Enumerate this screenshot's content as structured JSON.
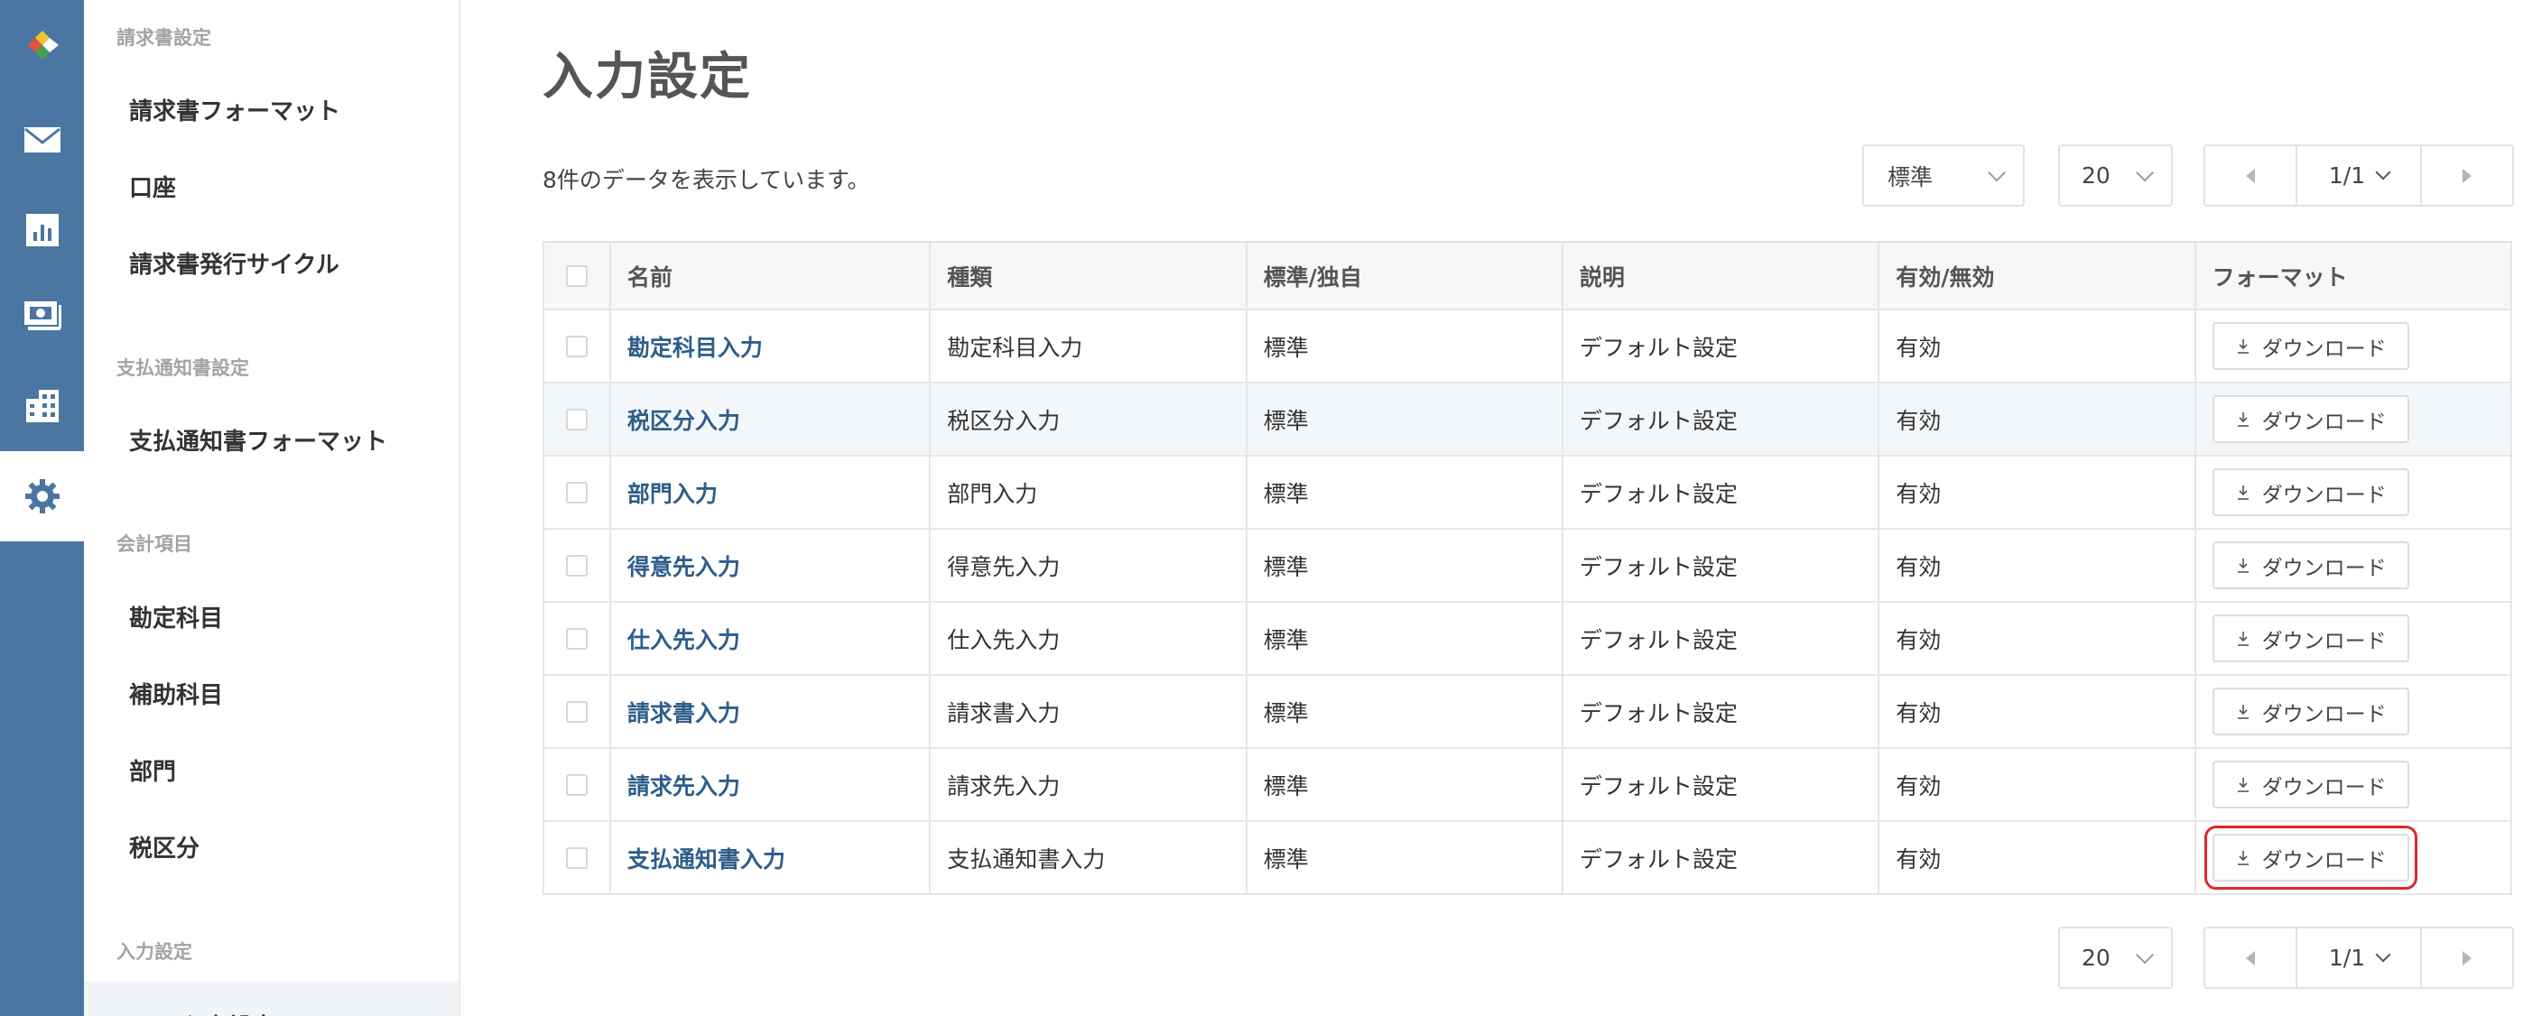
{
  "rail": {
    "items": [
      {
        "name": "logo-icon"
      },
      {
        "name": "mail-icon"
      },
      {
        "name": "report-icon"
      },
      {
        "name": "payment-icon"
      },
      {
        "name": "building-icon"
      },
      {
        "name": "settings-icon"
      }
    ]
  },
  "sidebar": {
    "sections": {
      "invoice": "請求書設定",
      "payment_notice": "支払通知書設定",
      "accounting": "会計項目",
      "input": "入力設定"
    },
    "items": [
      {
        "label": "請求書フォーマット"
      },
      {
        "label": "口座"
      },
      {
        "label": "請求書発行サイクル"
      },
      {
        "label": "支払通知書フォーマット"
      },
      {
        "label": "勘定科目"
      },
      {
        "label": "補助科目"
      },
      {
        "label": "部門"
      },
      {
        "label": "税区分"
      },
      {
        "label": "CSV入力設定"
      }
    ]
  },
  "main": {
    "title": "入力設定",
    "count_text": "8件のデータを表示しています。",
    "filter_value": "標準",
    "per_page": "20",
    "page_indicator": "1/1"
  },
  "table": {
    "headers": {
      "name": "名前",
      "type": "種類",
      "std": "標準/独自",
      "desc": "説明",
      "valid": "有効/無効",
      "format": "フォーマット"
    },
    "download_label": "ダウンロード",
    "rows": [
      {
        "name": "勘定科目入力",
        "type": "勘定科目入力",
        "std": "標準",
        "desc": "デフォルト設定",
        "valid": "有効"
      },
      {
        "name": "税区分入力",
        "type": "税区分入力",
        "std": "標準",
        "desc": "デフォルト設定",
        "valid": "有効"
      },
      {
        "name": "部門入力",
        "type": "部門入力",
        "std": "標準",
        "desc": "デフォルト設定",
        "valid": "有効"
      },
      {
        "name": "得意先入力",
        "type": "得意先入力",
        "std": "標準",
        "desc": "デフォルト設定",
        "valid": "有効"
      },
      {
        "name": "仕入先入力",
        "type": "仕入先入力",
        "std": "標準",
        "desc": "デフォルト設定",
        "valid": "有効"
      },
      {
        "name": "請求書入力",
        "type": "請求書入力",
        "std": "標準",
        "desc": "デフォルト設定",
        "valid": "有効"
      },
      {
        "name": "請求先入力",
        "type": "請求先入力",
        "std": "標準",
        "desc": "デフォルト設定",
        "valid": "有効"
      },
      {
        "name": "支払通知書入力",
        "type": "支払通知書入力",
        "std": "標準",
        "desc": "デフォルト設定",
        "valid": "有効"
      }
    ]
  },
  "colors": {
    "rail": "#4a76a1",
    "link": "#2f5d8a",
    "highlight": "#e0272b"
  }
}
